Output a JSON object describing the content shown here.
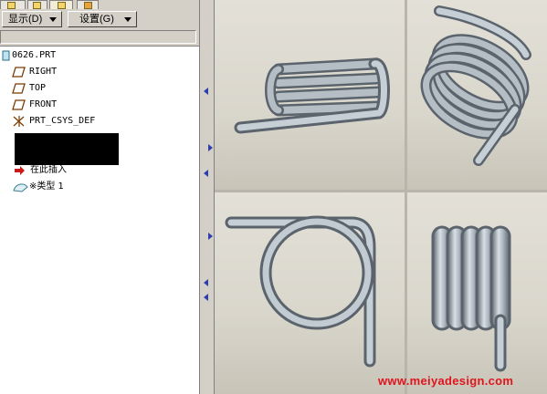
{
  "toolbar": {
    "show_label": "显示(D)",
    "settings_label": "设置(G)"
  },
  "tree": {
    "items": [
      {
        "label": "0626.PRT",
        "icon": "part-icon"
      },
      {
        "label": "RIGHT",
        "icon": "datum-plane-icon"
      },
      {
        "label": "TOP",
        "icon": "datum-plane-icon"
      },
      {
        "label": "FRONT",
        "icon": "datum-plane-icon"
      },
      {
        "label": "PRT_CSYS_DEF",
        "icon": "coordinate-system-icon"
      },
      {
        "label": "在此插入",
        "icon": "insert-here-arrow-icon"
      },
      {
        "label": "※类型 1",
        "icon": "sweep-feature-icon"
      }
    ]
  },
  "watermark": {
    "text": "www.meiyadesign.com"
  },
  "colors": {
    "panel_bg": "#d4d0c8",
    "tree_bg": "#ffffff",
    "spring_metal": "#a9b4bd",
    "watermark_red": "#e0141c",
    "arrow_blue": "#2b3fae"
  }
}
